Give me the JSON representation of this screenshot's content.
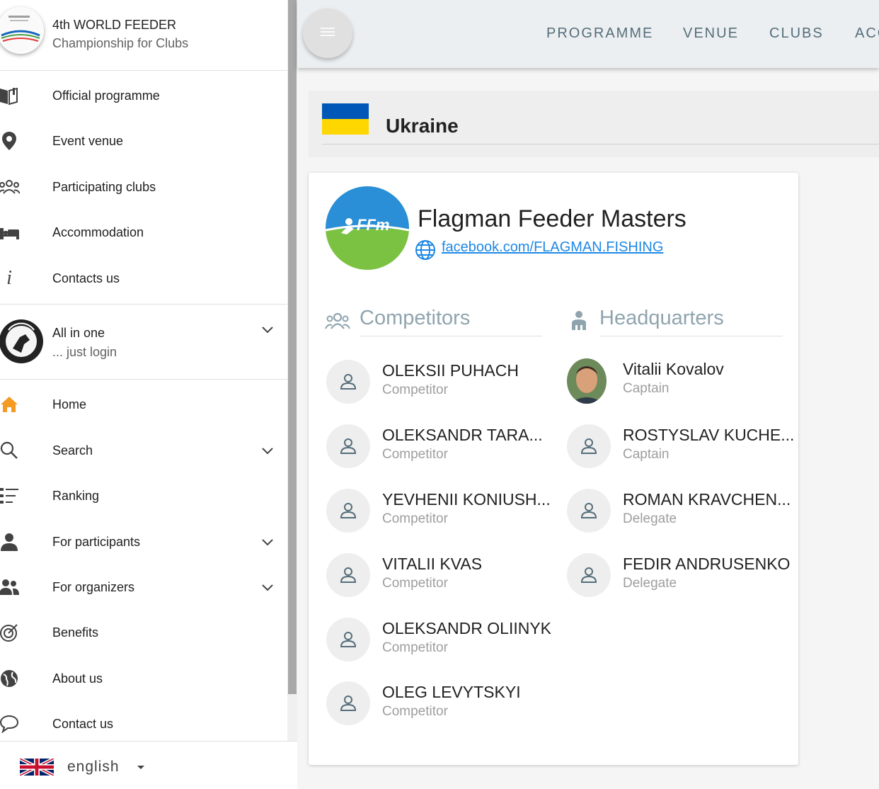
{
  "sidebar": {
    "title": "4th WORLD FEEDER",
    "subtitle": "Championship for Clubs",
    "event_items": [
      {
        "label": "Official programme",
        "icon": "book-open-icon"
      },
      {
        "label": "Event venue",
        "icon": "map-marker-icon"
      },
      {
        "label": "Participating clubs",
        "icon": "group-icon"
      },
      {
        "label": "Accommodation",
        "icon": "bed-icon"
      },
      {
        "label": "Contacts us",
        "icon": "info-icon"
      }
    ],
    "account": {
      "title": "All in one",
      "subtitle": "... just login"
    },
    "main_items": [
      {
        "label": "Home",
        "icon": "home-icon"
      },
      {
        "label": "Search",
        "icon": "search-icon"
      },
      {
        "label": "Ranking",
        "icon": "list-icon"
      },
      {
        "label": "For participants",
        "icon": "person-icon"
      },
      {
        "label": "For organizers",
        "icon": "people-icon"
      },
      {
        "label": "Benefits",
        "icon": "target-icon"
      },
      {
        "label": "About us",
        "icon": "globe-icon"
      },
      {
        "label": "Contact us",
        "icon": "chat-bubble-icon"
      }
    ],
    "language": "english"
  },
  "topnav": {
    "links": [
      "PROGRAMME",
      "VENUE",
      "CLUBS",
      "ACC"
    ]
  },
  "country": {
    "name": "Ukraine",
    "flag_colors": [
      "#0057b7",
      "#ffd700"
    ]
  },
  "club": {
    "name": "Flagman Feeder Masters",
    "link": "facebook.com/FLAGMAN.FISHING",
    "logo_text": "FFm"
  },
  "competitors": {
    "title": "Competitors",
    "people": [
      {
        "name": "OLEKSII PUHACH",
        "role": "Competitor"
      },
      {
        "name": "OLEKSANDR TARA...",
        "role": "Competitor"
      },
      {
        "name": "YEVHENII KONIUSH...",
        "role": "Competitor"
      },
      {
        "name": "VITALII KVAS",
        "role": "Competitor"
      },
      {
        "name": "OLEKSANDR OLIINYK",
        "role": "Competitor"
      },
      {
        "name": "OLEG LEVYTSKYI",
        "role": "Competitor"
      }
    ]
  },
  "headquarters": {
    "title": "Headquarters",
    "people": [
      {
        "name": "Vitalii Kovalov",
        "role": "Captain"
      },
      {
        "name": "ROSTYSLAV KUCHE...",
        "role": "Captain"
      },
      {
        "name": "ROMAN KRAVCHEN...",
        "role": "Delegate"
      },
      {
        "name": "FEDIR ANDRUSENKO",
        "role": "Delegate"
      }
    ]
  }
}
